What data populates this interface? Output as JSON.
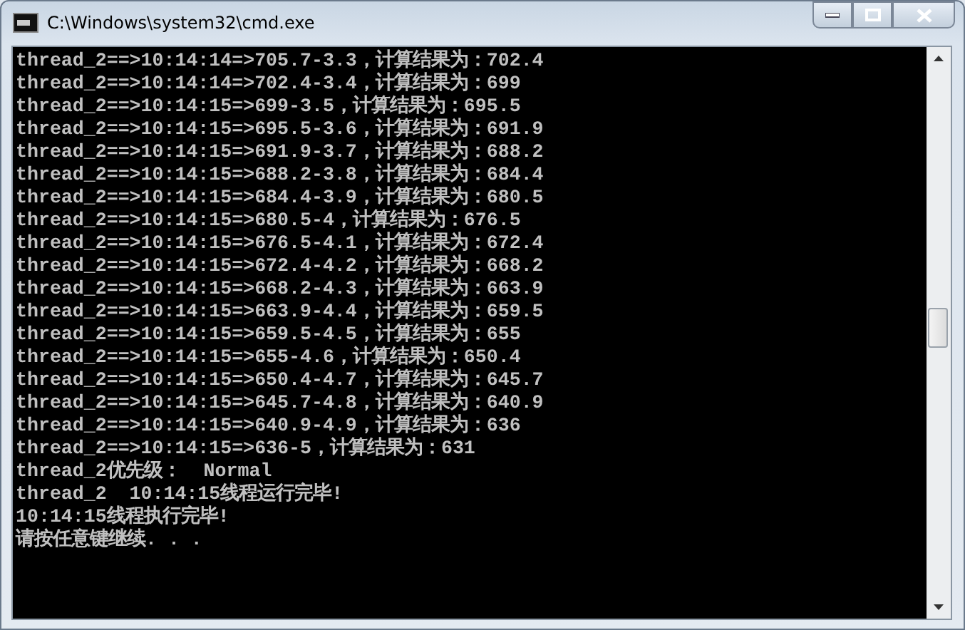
{
  "window": {
    "title": "C:\\Windows\\system32\\cmd.exe"
  },
  "console": {
    "lines": [
      "thread_2==>10:14:14=>705.7-3.3，计算结果为：702.4",
      "thread_2==>10:14:14=>702.4-3.4，计算结果为：699",
      "thread_2==>10:14:15=>699-3.5，计算结果为：695.5",
      "thread_2==>10:14:15=>695.5-3.6，计算结果为：691.9",
      "thread_2==>10:14:15=>691.9-3.7，计算结果为：688.2",
      "thread_2==>10:14:15=>688.2-3.8，计算结果为：684.4",
      "thread_2==>10:14:15=>684.4-3.9，计算结果为：680.5",
      "thread_2==>10:14:15=>680.5-4，计算结果为：676.5",
      "thread_2==>10:14:15=>676.5-4.1，计算结果为：672.4",
      "thread_2==>10:14:15=>672.4-4.2，计算结果为：668.2",
      "thread_2==>10:14:15=>668.2-4.3，计算结果为：663.9",
      "thread_2==>10:14:15=>663.9-4.4，计算结果为：659.5",
      "thread_2==>10:14:15=>659.5-4.5，计算结果为：655",
      "thread_2==>10:14:15=>655-4.6，计算结果为：650.4",
      "thread_2==>10:14:15=>650.4-4.7，计算结果为：645.7",
      "thread_2==>10:14:15=>645.7-4.8，计算结果为：640.9",
      "thread_2==>10:14:15=>640.9-4.9，计算结果为：636",
      "thread_2==>10:14:15=>636-5，计算结果为：631",
      "thread_2优先级：  Normal",
      "thread_2  10:14:15线程运行完毕!",
      "10:14:15线程执行完毕!",
      "请按任意键继续. . ."
    ]
  }
}
